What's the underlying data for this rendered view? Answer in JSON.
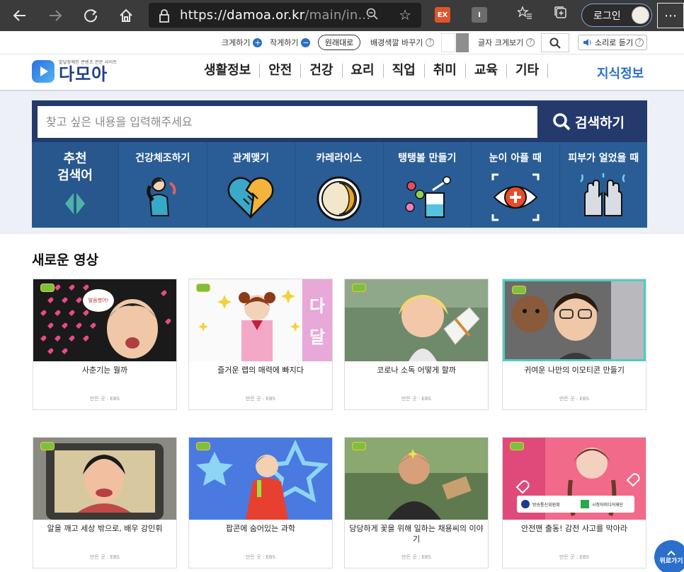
{
  "browser": {
    "url_scheme": "https://",
    "url_host": "damoa.or.kr",
    "url_path": "/main/in...",
    "ext_ex_label": "EX",
    "ext_i_label": "I",
    "login_label": "로그인",
    "more_label": "⋯"
  },
  "accessibility": {
    "enlarge_label": "크게하기",
    "shrink_label": "작게하기",
    "reset_label": "원래대로",
    "bg_color_label": "배경색깔 바꾸기",
    "font_view_label": "글자 크게보기",
    "listen_label": "소리로 듣기",
    "help_glyph": "?"
  },
  "header": {
    "logo_sub": "발달장애인 콘텐츠 전문 사이트",
    "logo_name": "다모아",
    "nav": [
      "생활정보",
      "안전",
      "건강",
      "요리",
      "직업",
      "취미",
      "교육",
      "기타"
    ],
    "knowledge_label": "지식정보"
  },
  "search": {
    "placeholder": "찾고 싶은 내용을 입력해주세요",
    "button_label": "검색하기",
    "recommend_label_1": "추천",
    "recommend_label_2": "검색어",
    "recommended": [
      "건강체조하기",
      "관계맺기",
      "카레라이스",
      "탱탱볼 만들기",
      "눈이 아플 때",
      "피부가 얼었을 때"
    ]
  },
  "videos": {
    "section_title": "새로운 영상",
    "source_label": "만든 곳 : EBS",
    "items": [
      {
        "title": "사춘기는 뭘까"
      },
      {
        "title": "즐거운 랩의 매력에 빠지다"
      },
      {
        "title": "코로나 소독 어떻게 할까"
      },
      {
        "title": "귀여운 나만의 이모티콘 만들기"
      },
      {
        "title": "알을 깨고 세상 밖으로, 배우 강민휘"
      },
      {
        "title": "팝콘에 숨어있는 과학"
      },
      {
        "title": "당당하게 꽃을 위해 일하는 채용씨의 이야기"
      },
      {
        "title": "안전맨 출동! 감전 사고를 막아라"
      }
    ]
  },
  "thumb_text": {
    "bubble": "발음했어!",
    "letter_1": "다",
    "letter_2": "달",
    "org_1": "방송통신위원회",
    "org_2": "시청자미디어재단"
  },
  "top_button_label": "위로가기",
  "colors": {
    "brand_blue": "#2a6fc9",
    "search_navy": "#24396c",
    "recommend_blue": "#2a5d95"
  }
}
